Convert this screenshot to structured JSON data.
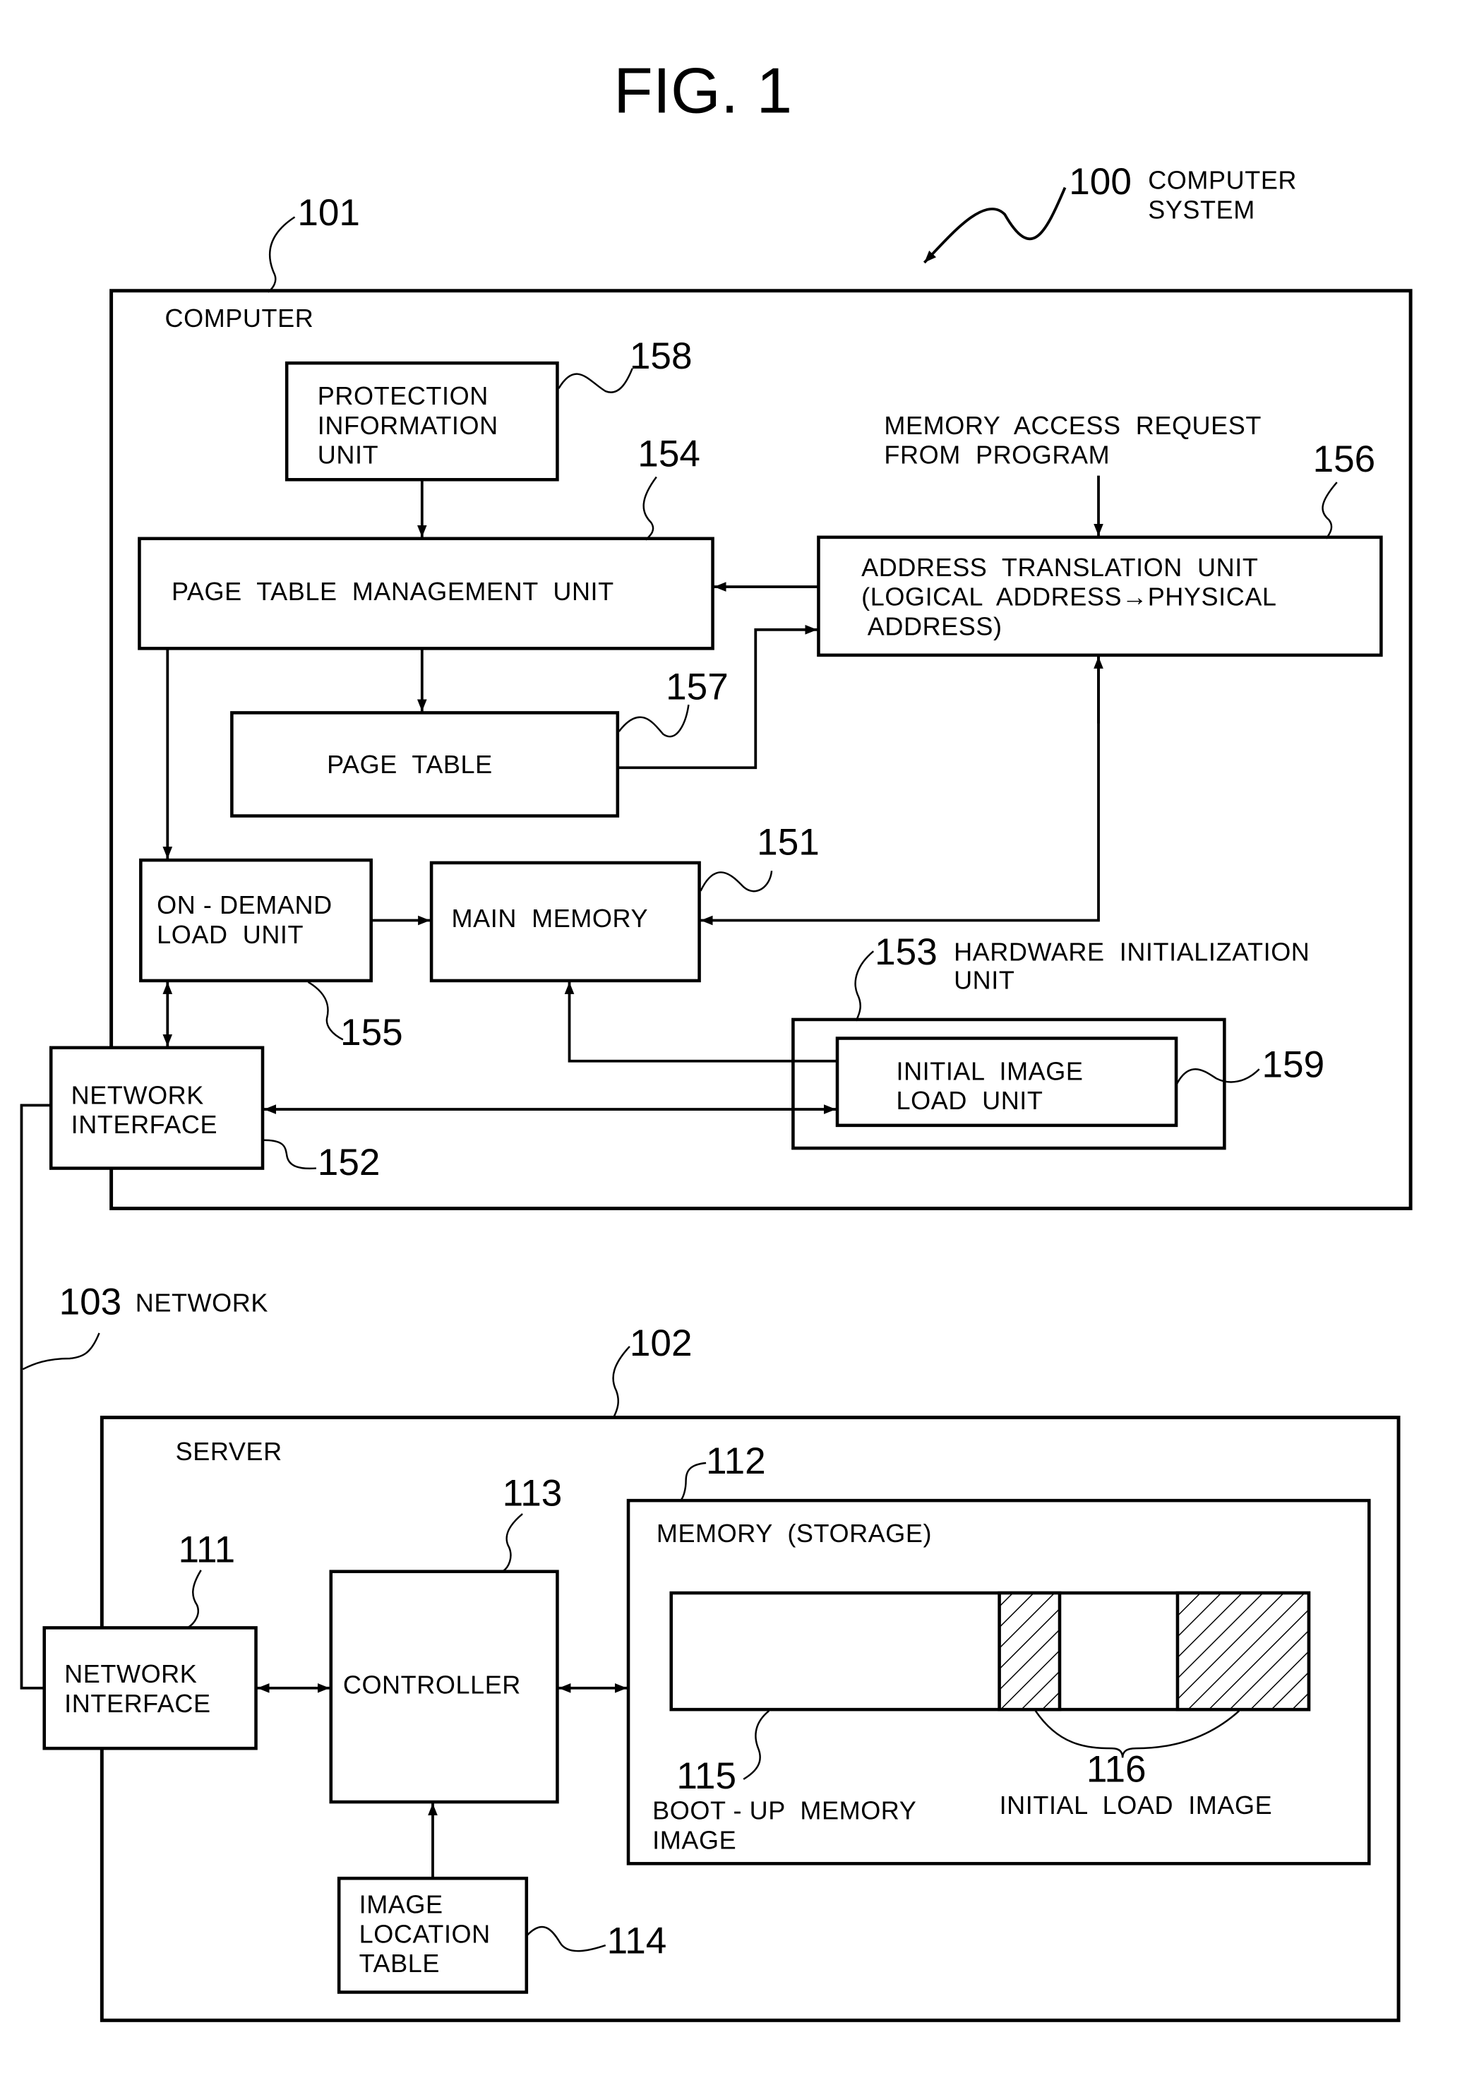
{
  "figure": {
    "title": "FIG. 1",
    "system": {
      "ref": "100",
      "label_line1": "COMPUTER",
      "label_line2": "SYSTEM"
    }
  },
  "computer": {
    "ref": "101",
    "label": "COMPUTER",
    "protection_information_unit": {
      "ref": "158",
      "lines": [
        "PROTECTION",
        "INFORMATION",
        "UNIT"
      ]
    },
    "page_table_management_unit": {
      "ref": "154",
      "label": "PAGE  TABLE  MANAGEMENT  UNIT"
    },
    "memory_access_request": {
      "lines": [
        "MEMORY  ACCESS  REQUEST",
        "FROM  PROGRAM"
      ]
    },
    "address_translation_unit": {
      "ref": "156",
      "lines": [
        "ADDRESS  TRANSLATION  UNIT",
        "(LOGICAL  ADDRESS→PHYSICAL",
        " ADDRESS)"
      ]
    },
    "page_table": {
      "ref": "157",
      "label": "PAGE  TABLE"
    },
    "on_demand_load_unit": {
      "ref": "155",
      "lines": [
        "ON - DEMAND",
        "LOAD  UNIT"
      ]
    },
    "main_memory": {
      "ref": "151",
      "label": "MAIN  MEMORY"
    },
    "hardware_initialization_unit": {
      "ref": "153",
      "lines": [
        "HARDWARE  INITIALIZATION",
        "UNIT"
      ]
    },
    "initial_image_load_unit": {
      "ref": "159",
      "lines": [
        "INITIAL  IMAGE",
        "LOAD  UNIT"
      ]
    },
    "network_interface": {
      "ref": "152",
      "lines": [
        "NETWORK",
        "INTERFACE"
      ]
    }
  },
  "network": {
    "ref": "103",
    "label": "NETWORK"
  },
  "server": {
    "ref": "102",
    "label": "SERVER",
    "network_interface": {
      "ref": "111",
      "lines": [
        "NETWORK",
        "INTERFACE"
      ]
    },
    "controller": {
      "ref": "113",
      "label": "CONTROLLER"
    },
    "image_location_table": {
      "ref": "114",
      "lines": [
        "IMAGE",
        "LOCATION",
        "TABLE"
      ]
    },
    "memory_storage": {
      "ref": "112",
      "label": "MEMORY  (STORAGE)",
      "boot_up_memory_image": {
        "ref": "115",
        "lines": [
          "BOOT - UP  MEMORY",
          "IMAGE"
        ]
      },
      "initial_load_image": {
        "ref": "116",
        "label": "INITIAL  LOAD  IMAGE"
      }
    }
  }
}
